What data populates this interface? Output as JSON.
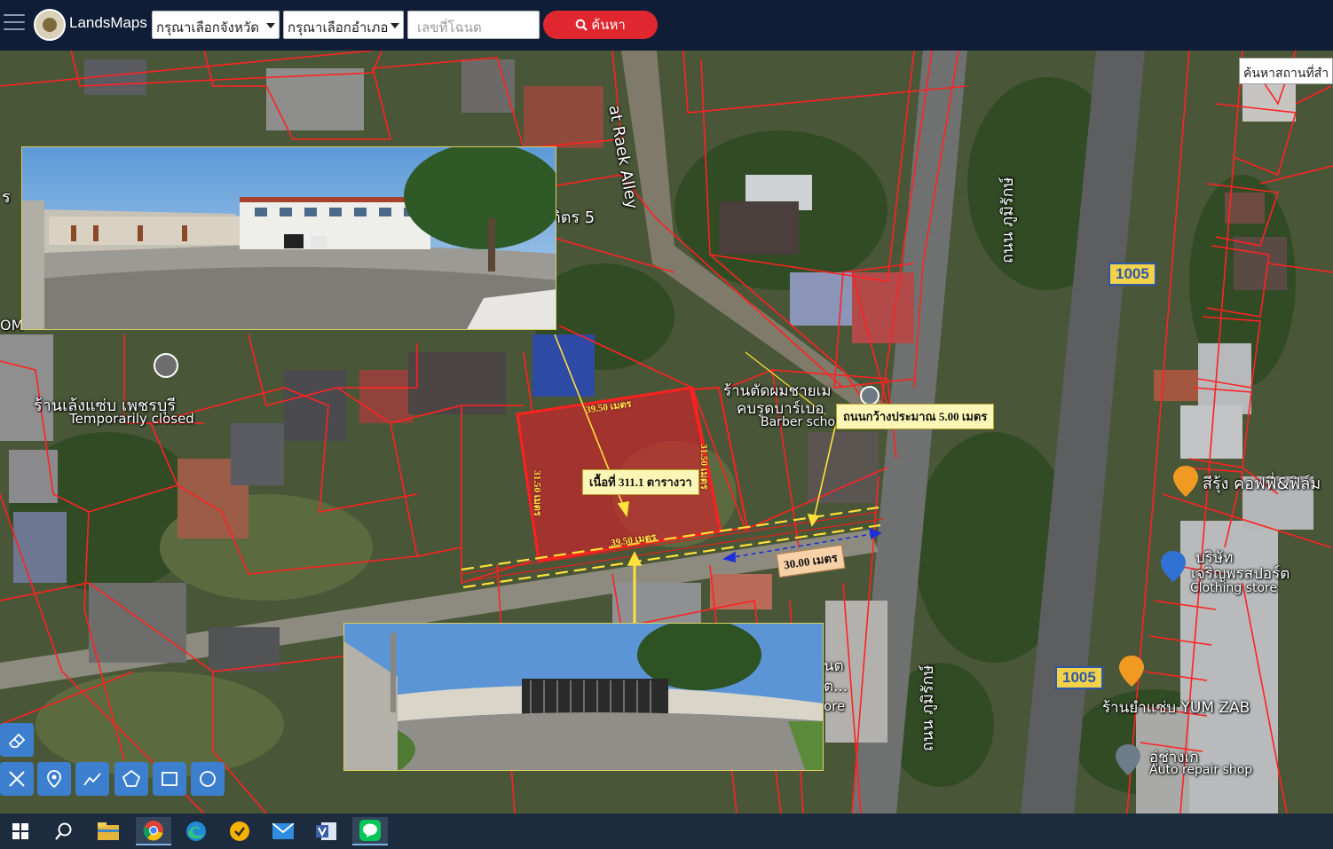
{
  "app": {
    "name": "LandsMaps",
    "province_select": "กรุณาเลือกจังหวัด",
    "district_select": "กรุณาเลือกอำเภอ",
    "deed_placeholder": "เลขที่โฉนด",
    "search_button": "ค้นหา",
    "place_search": "ค้นหาสถานที่สำ"
  },
  "map": {
    "labels": {
      "alley": "at Raek Alley",
      "soi": "ติตร 5",
      "road1": "ถนน ภูมิรักษ์",
      "road2": "ถนน ภูมิรักษ์",
      "shop_name": "ร้านเล้งแซ่บ เพชรบุรี",
      "shop_status": "Temporarily closed",
      "barber_th1": "ร้านตัดผมชายเม",
      "barber_th2": "คบรูดบาร์เบอ",
      "barber_en": "Barber school",
      "cafe": "สีรุ้ง คอฟฟี่&ฟิล์ม",
      "sport_th1": "บริษัท",
      "sport_th2": "เจริญพรสปอร์ต",
      "sport_en": "Clothing store",
      "yumzab": "ร้านยำแซ่บ YUM ZAB",
      "repair_th": "อู่ช่างเก",
      "repair_en": "Auto repair shop",
      "left_edge1": "ร",
      "left_edge2": "OM",
      "partial1": "นต",
      "partial2": "ต...",
      "partial3": "ore"
    },
    "route_shield": "1005",
    "route_shield2": "1005",
    "annotations": {
      "area": "เนื้อที่ 311.1 ตารางวา",
      "road_width": "ถนนกว้างประมาณ 5.00 เมตร",
      "frontage": "30.00 เมตร",
      "dim_top": "39.50 เมตร",
      "dim_bottom": "39.50 เมตร",
      "dim_left": "31.50 เมตร",
      "dim_right": "31.50 เมตร"
    }
  },
  "icons": {
    "tools": [
      "eraser-icon",
      "clear-draw-icon",
      "marker-icon",
      "polyline-icon",
      "polygon-icon",
      "rectangle-icon",
      "circle-icon"
    ],
    "taskbar": [
      "windows-start-icon",
      "search-icon",
      "file-explorer-icon",
      "chrome-icon",
      "edge-icon",
      "norton-icon",
      "mail-icon",
      "visio-icon",
      "line-icon"
    ]
  },
  "colors": {
    "topbar": "#0f1e36",
    "search_button": "#e0272f",
    "parcel_line": "#ff2020",
    "highlight_parcel": "#e0202a",
    "tool_button": "#3d7fcf",
    "taskbar": "#1c2b3d"
  }
}
